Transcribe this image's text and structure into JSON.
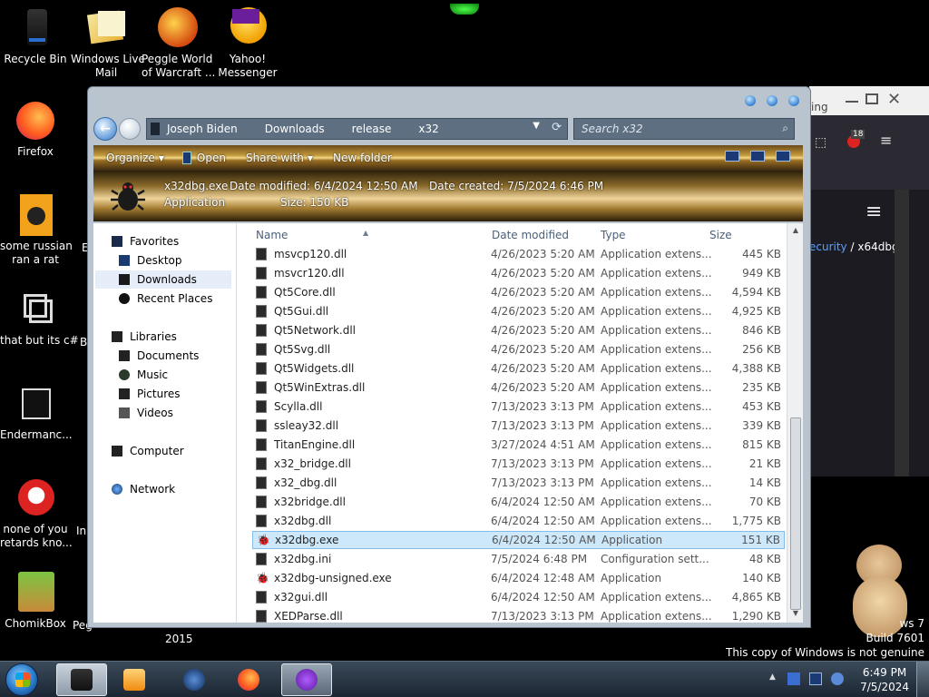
{
  "desktop": {
    "icons": [
      {
        "lines": [
          "Recycle Bin"
        ]
      },
      {
        "lines": [
          "Windows Live",
          "Mail"
        ]
      },
      {
        "lines": [
          "Peggle World",
          "of Warcraft ..."
        ]
      },
      {
        "lines": [
          "Yahoo!",
          "Messenger"
        ]
      },
      {
        "lines": [
          "Firefox"
        ]
      },
      {
        "lines": [
          "some russian",
          "ran a rat"
        ]
      },
      {
        "lines": [
          "that but its c#"
        ]
      },
      {
        "lines": [
          "Endermanc..."
        ]
      },
      {
        "lines": [
          "none of you",
          "retards kno..."
        ]
      },
      {
        "lines": [
          "ChomikBox"
        ]
      }
    ],
    "partial_labels": [
      "E",
      "B",
      "In",
      "Peg",
      "2015"
    ],
    "watermark": {
      "line1": "ws 7",
      "line2": "Build 7601",
      "line3": "This copy of Windows is not genuine"
    }
  },
  "browser_partial": {
    "text_a": "ing",
    "badge": "18",
    "breadcrumb_link": "ecurity",
    "breadcrumb_rest": " / x64dbg"
  },
  "explorer": {
    "address": {
      "crumbs": [
        "Joseph Biden",
        "Downloads",
        "release",
        "x32"
      ]
    },
    "search": {
      "placeholder": "Search x32"
    },
    "toolbar": {
      "organize": "Organize",
      "open": "Open",
      "share_with": "Share with",
      "new_folder": "New folder"
    },
    "details": {
      "name": "x32dbg.exe",
      "kind": "Application",
      "date_modified": "Date modified: 6/4/2024 12:50 AM",
      "size": "Size: 150 KB",
      "date_created": "Date created: 7/5/2024 6:46 PM"
    },
    "nav": {
      "favorites": "Favorites",
      "desktop": "Desktop",
      "downloads": "Downloads",
      "recent": "Recent Places",
      "libraries": "Libraries",
      "documents": "Documents",
      "music": "Music",
      "pictures": "Pictures",
      "videos": "Videos",
      "computer": "Computer",
      "network": "Network"
    },
    "columns": {
      "name": "Name",
      "date": "Date modified",
      "type": "Type",
      "size": "Size"
    },
    "files": [
      {
        "name": "msvcp120.dll",
        "date": "4/26/2023 5:20 AM",
        "type": "Application extens...",
        "size": "445 KB"
      },
      {
        "name": "msvcr120.dll",
        "date": "4/26/2023 5:20 AM",
        "type": "Application extens...",
        "size": "949 KB"
      },
      {
        "name": "Qt5Core.dll",
        "date": "4/26/2023 5:20 AM",
        "type": "Application extens...",
        "size": "4,594 KB"
      },
      {
        "name": "Qt5Gui.dll",
        "date": "4/26/2023 5:20 AM",
        "type": "Application extens...",
        "size": "4,925 KB"
      },
      {
        "name": "Qt5Network.dll",
        "date": "4/26/2023 5:20 AM",
        "type": "Application extens...",
        "size": "846 KB"
      },
      {
        "name": "Qt5Svg.dll",
        "date": "4/26/2023 5:20 AM",
        "type": "Application extens...",
        "size": "256 KB"
      },
      {
        "name": "Qt5Widgets.dll",
        "date": "4/26/2023 5:20 AM",
        "type": "Application extens...",
        "size": "4,388 KB"
      },
      {
        "name": "Qt5WinExtras.dll",
        "date": "4/26/2023 5:20 AM",
        "type": "Application extens...",
        "size": "235 KB"
      },
      {
        "name": "Scylla.dll",
        "date": "7/13/2023 3:13 PM",
        "type": "Application extens...",
        "size": "453 KB"
      },
      {
        "name": "ssleay32.dll",
        "date": "7/13/2023 3:13 PM",
        "type": "Application extens...",
        "size": "339 KB"
      },
      {
        "name": "TitanEngine.dll",
        "date": "3/27/2024 4:51 AM",
        "type": "Application extens...",
        "size": "815 KB"
      },
      {
        "name": "x32_bridge.dll",
        "date": "7/13/2023 3:13 PM",
        "type": "Application extens...",
        "size": "21 KB"
      },
      {
        "name": "x32_dbg.dll",
        "date": "7/13/2023 3:13 PM",
        "type": "Application extens...",
        "size": "14 KB"
      },
      {
        "name": "x32bridge.dll",
        "date": "6/4/2024 12:50 AM",
        "type": "Application extens...",
        "size": "70 KB"
      },
      {
        "name": "x32dbg.dll",
        "date": "6/4/2024 12:50 AM",
        "type": "Application extens...",
        "size": "1,775 KB"
      },
      {
        "name": "x32dbg.exe",
        "date": "6/4/2024 12:50 AM",
        "type": "Application",
        "size": "151 KB",
        "selected": true
      },
      {
        "name": "x32dbg.ini",
        "date": "7/5/2024 6:48 PM",
        "type": "Configuration sett...",
        "size": "48 KB"
      },
      {
        "name": "x32dbg-unsigned.exe",
        "date": "6/4/2024 12:48 AM",
        "type": "Application",
        "size": "140 KB"
      },
      {
        "name": "x32gui.dll",
        "date": "6/4/2024 12:50 AM",
        "type": "Application extens...",
        "size": "4,865 KB"
      },
      {
        "name": "XEDParse.dll",
        "date": "7/13/2023 3:13 PM",
        "type": "Application extens...",
        "size": "1,290 KB"
      }
    ]
  },
  "taskbar": {
    "time": "6:49 PM",
    "date": "7/5/2024"
  },
  "colors": {
    "selection": "#cde8fa",
    "accent": "#3b7fd0"
  }
}
